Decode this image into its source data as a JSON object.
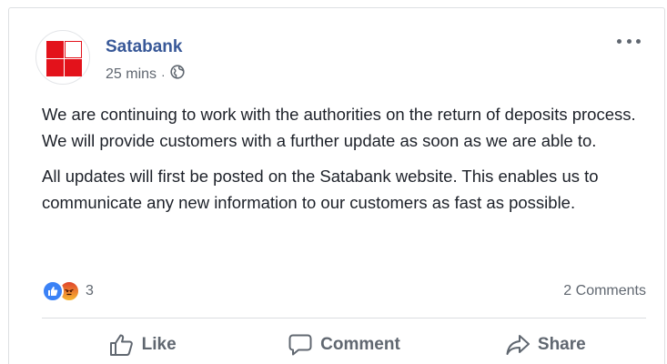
{
  "post": {
    "author": "Satabank",
    "time": "25 mins",
    "separator": "·",
    "audience_icon": "globe-icon",
    "more_icon": "more-options-icon",
    "paragraphs": [
      "We are continuing to work with the authorities on the return of deposits process. We will provide customers with a further update as soon as we are able to.",
      "All updates will first be posted on the Satabank website. This enables us to communicate any new information to our customers as fast as possible."
    ]
  },
  "reactions": {
    "types": [
      "like-icon",
      "angry-icon"
    ],
    "count": "3"
  },
  "comments": {
    "label": "2 Comments"
  },
  "actions": {
    "like": "Like",
    "comment": "Comment",
    "share": "Share"
  },
  "colors": {
    "author_link": "#385898",
    "brand_red": "#e3121b",
    "secondary_text": "#606770",
    "like_blue": "#3b82f6"
  }
}
